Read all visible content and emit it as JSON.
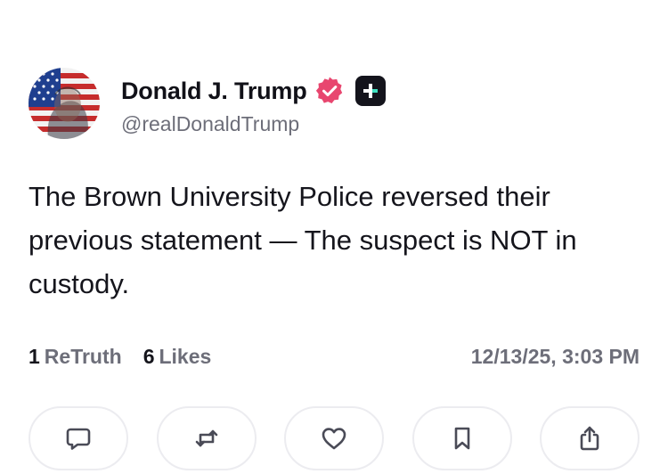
{
  "author": {
    "display_name": "Donald J. Trump",
    "handle": "@realDonaldTrump",
    "avatar_icon": "flag-portrait-avatar",
    "verified_color": "#e8466f"
  },
  "post": {
    "text": "The Brown University Police reversed their previous statement — The suspect is NOT in custody."
  },
  "stats": {
    "retruths_count": "1",
    "retruths_label": "ReTruth",
    "likes_count": "6",
    "likes_label": "Likes",
    "timestamp": "12/13/25, 3:03 PM"
  },
  "actions": [
    {
      "name": "reply",
      "icon": "comment-icon"
    },
    {
      "name": "retruth",
      "icon": "repost-icon"
    },
    {
      "name": "like",
      "icon": "heart-icon"
    },
    {
      "name": "bookmark",
      "icon": "bookmark-icon"
    },
    {
      "name": "share",
      "icon": "share-icon"
    }
  ]
}
